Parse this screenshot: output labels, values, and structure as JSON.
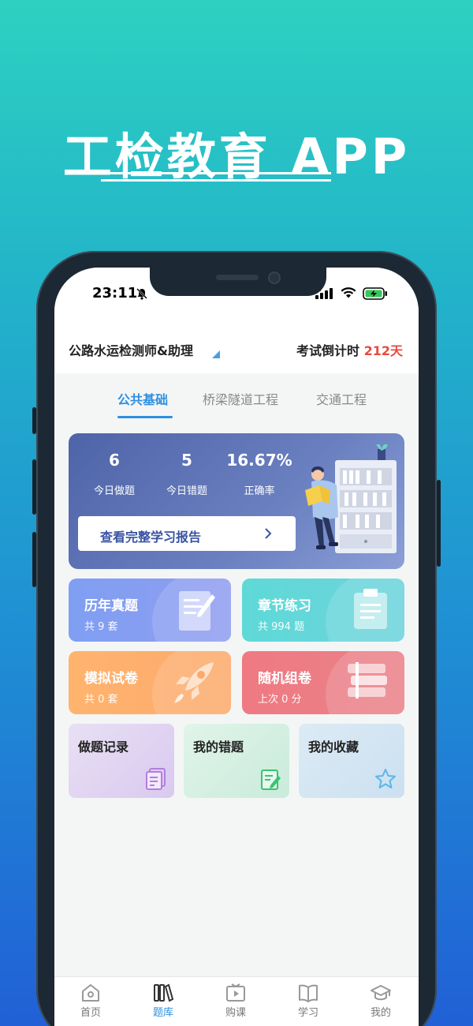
{
  "promo": {
    "title": "工检教育 APP"
  },
  "status_bar": {
    "time": "23:11"
  },
  "header": {
    "exam_name": "公路水运检测师&助理",
    "countdown_label": "考试倒计时",
    "countdown_days": "212天"
  },
  "tabs": [
    {
      "label": "公共基础",
      "active": true
    },
    {
      "label": "桥梁隧道工程",
      "active": false
    },
    {
      "label": "交通工程",
      "active": false
    }
  ],
  "stats": [
    {
      "value": "6",
      "label": "今日做题"
    },
    {
      "value": "5",
      "label": "今日错题"
    },
    {
      "value": "16.67%",
      "label": "正确率"
    }
  ],
  "report_button": {
    "label": "查看完整学习报告"
  },
  "modules": [
    {
      "title": "历年真题",
      "subtitle": "共 9 套",
      "icon": "document-edit-icon",
      "color": "#7a9bf0"
    },
    {
      "title": "章节练习",
      "subtitle": "共 994 题",
      "icon": "clipboard-icon",
      "color": "#5dd6d6"
    },
    {
      "title": "模拟试卷",
      "subtitle": "共 0 套",
      "icon": "rocket-icon",
      "color": "#ffae6a"
    },
    {
      "title": "随机组卷",
      "subtitle": "上次 0 分",
      "icon": "books-icon",
      "color": "#ee7f87"
    }
  ],
  "quick_links": [
    {
      "title": "做题记录",
      "icon": "records-icon"
    },
    {
      "title": "我的错题",
      "icon": "wrong-answers-icon"
    },
    {
      "title": "我的收藏",
      "icon": "star-icon"
    }
  ],
  "bottom_nav": [
    {
      "label": "首页",
      "icon": "home-icon",
      "active": false
    },
    {
      "label": "题库",
      "icon": "library-icon",
      "active": true
    },
    {
      "label": "购课",
      "icon": "video-course-icon",
      "active": false
    },
    {
      "label": "学习",
      "icon": "book-icon",
      "active": false
    },
    {
      "label": "我的",
      "icon": "graduation-cap-icon",
      "active": false
    }
  ]
}
